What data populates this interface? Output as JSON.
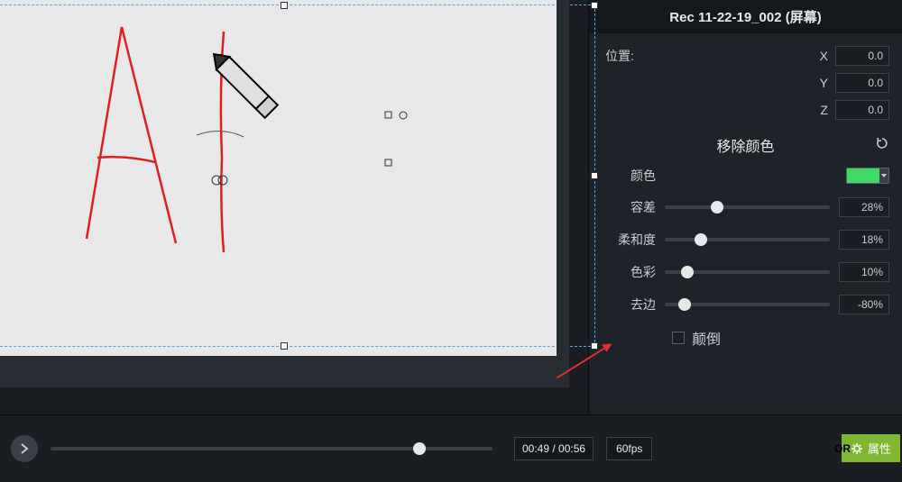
{
  "title": "Rec 11-22-19_002 (屏幕)",
  "position": {
    "label": "位置:",
    "x_label": "X",
    "x_value": "0.0",
    "y_label": "Y",
    "y_value": "0.0",
    "z_label": "Z",
    "z_value": "0.0"
  },
  "remove_color": {
    "title": "移除颜色",
    "color_label": "颜色",
    "color_value": "#3fd968",
    "tolerance_label": "容差",
    "tolerance_value": "28%",
    "tolerance_pct": 28,
    "softness_label": "柔和度",
    "softness_value": "18%",
    "softness_pct": 18,
    "hue_label": "色彩",
    "hue_value": "10%",
    "hue_pct": 10,
    "defringe_label": "去边",
    "defringe_value": "-80%",
    "defringe_pct": 8,
    "invert_label": "颠倒"
  },
  "timeline": {
    "current": "00:49",
    "total": "00:56",
    "fps": "60fps",
    "progress_pct": 82
  },
  "properties_btn": "属性"
}
